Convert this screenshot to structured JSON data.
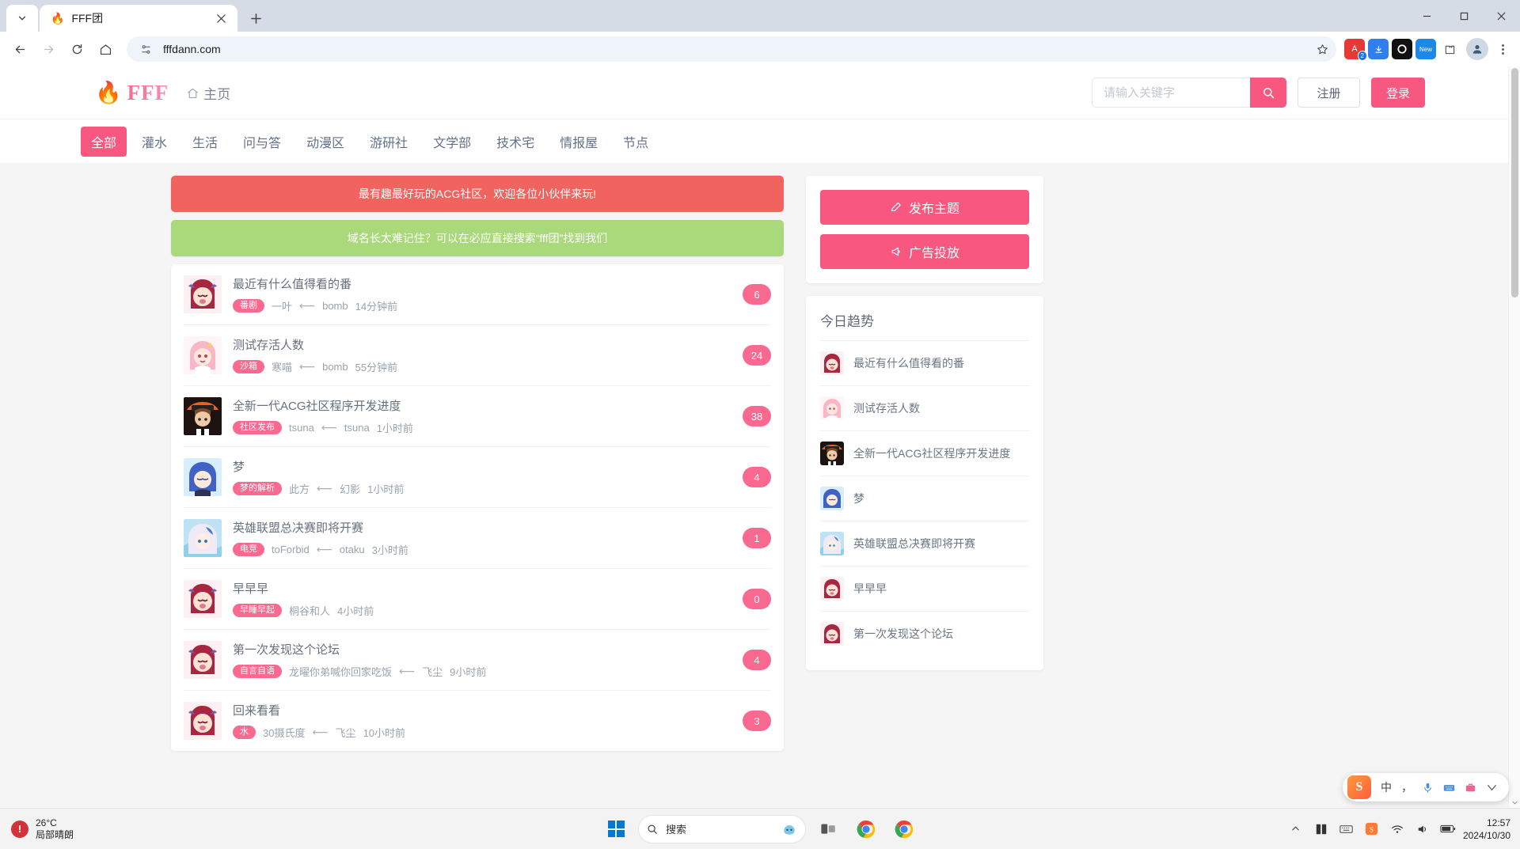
{
  "browser": {
    "tab": {
      "title": "FFF团",
      "favicon": "flame-icon"
    },
    "url": "fffdann.com",
    "extension_badge": "2",
    "extension_new_label": "New"
  },
  "site": {
    "brand_text": "FFF",
    "home_label": "主页",
    "search_placeholder": "请输入关键字",
    "search_value": "",
    "register_label": "注册",
    "login_label": "登录",
    "nav": [
      {
        "label": "全部",
        "active": true
      },
      {
        "label": "灌水",
        "active": false
      },
      {
        "label": "生活",
        "active": false
      },
      {
        "label": "问与答",
        "active": false
      },
      {
        "label": "动漫区",
        "active": false
      },
      {
        "label": "游研社",
        "active": false
      },
      {
        "label": "文学部",
        "active": false
      },
      {
        "label": "技术宅",
        "active": false
      },
      {
        "label": "情报屋",
        "active": false
      },
      {
        "label": "节点",
        "active": false
      }
    ],
    "notices": [
      {
        "text": "最有趣最好玩的ACG社区，欢迎各位小伙伴来玩!",
        "color": "#f1635e"
      },
      {
        "text": "域名长太难记住？可以在必应直接搜索“fff团”找到我们",
        "color": "#a9d97a"
      }
    ],
    "posts": [
      {
        "title": "最近有什么值得看的番",
        "tag": "番剧",
        "author": "一叶",
        "arrow": "⟵",
        "replier": "bomb",
        "time": "14分钟前",
        "count": "6"
      },
      {
        "title": "测试存活人数",
        "tag": "沙箱",
        "author": "寒喵",
        "arrow": "⟵",
        "replier": "bomb",
        "time": "55分钟前",
        "count": "24"
      },
      {
        "title": "全新一代ACG社区程序开发进度",
        "tag": "社区发布",
        "author": "tsuna",
        "arrow": "⟵",
        "replier": "tsuna",
        "time": "1小时前",
        "count": "38"
      },
      {
        "title": "梦",
        "tag": "梦的解析",
        "author": "此方",
        "arrow": "⟵",
        "replier": "幻影",
        "time": "1小时前",
        "count": "4"
      },
      {
        "title": "英雄联盟总决赛即将开赛",
        "tag": "电竞",
        "author": "toForbid",
        "arrow": "⟵",
        "replier": "otaku",
        "time": "3小时前",
        "count": "1"
      },
      {
        "title": "早早早",
        "tag": "早睡早起",
        "author": "桐谷和人",
        "arrow": "",
        "replier": "",
        "time": "4小时前",
        "count": "0"
      },
      {
        "title": "第一次发现这个论坛",
        "tag": "自言自语",
        "author": "龙曜你弟喊你回家吃饭",
        "arrow": "⟵",
        "replier": "飞尘",
        "time": "9小时前",
        "count": "4"
      },
      {
        "title": "回来看看",
        "tag": "水",
        "author": "30摄氏度",
        "arrow": "⟵",
        "replier": "飞尘",
        "time": "10小时前",
        "count": "3"
      }
    ],
    "sidebar": {
      "post_button": "发布主题",
      "ad_button": "广告投放",
      "trending_title": "今日趋势",
      "trending": [
        {
          "title": "最近有什么值得看的番"
        },
        {
          "title": "测试存活人数"
        },
        {
          "title": "全新一代ACG社区程序开发进度"
        },
        {
          "title": "梦"
        },
        {
          "title": "英雄联盟总决赛即将开赛"
        },
        {
          "title": "早早早"
        },
        {
          "title": "第一次发现这个论坛"
        }
      ]
    }
  },
  "taskbar": {
    "weather_temp": "26°C",
    "weather_desc": "局部晴朗",
    "search_placeholder": "搜索",
    "time": "12:57",
    "date": "2024/10/30",
    "ime": {
      "lang": "中",
      "punct": "，"
    }
  },
  "colors": {
    "accent": "#f8577f",
    "tag": "#fa6a90",
    "notice_red": "#f1635e",
    "notice_green": "#a9d97a"
  }
}
